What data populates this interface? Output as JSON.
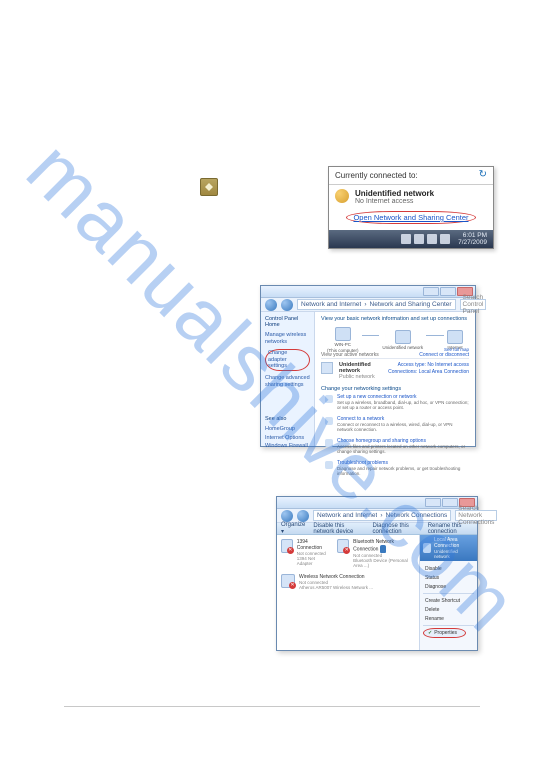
{
  "watermark": "manualshive.com",
  "tray_icon": {
    "name": "network-tray"
  },
  "flyout": {
    "heading": "Currently connected to:",
    "network": {
      "name": "Unidentified network",
      "sub": "No Internet access"
    },
    "link": "Open Network and Sharing Center",
    "clock": {
      "time": "6:01 PM",
      "date": "7/27/2009"
    }
  },
  "win2": {
    "crumb_a": "Network and Internet",
    "crumb_b": "Network and Sharing Center",
    "search_ph": "Search Control Panel",
    "side": {
      "header": "Control Panel Home",
      "link1": "Manage wireless networks",
      "link2": "Change adapter settings",
      "link3": "Change advanced sharing settings",
      "see_also": "See also",
      "sa1": "HomeGroup",
      "sa2": "Internet Options",
      "sa3": "Windows Firewall"
    },
    "main": {
      "heading": "View your basic network information and set up connections",
      "node_pc": "WIN-PC",
      "node_pc_sub": "(This computer)",
      "node_net": "Unidentified network",
      "node_inet": "Internet",
      "see_full": "See full map",
      "view_active": "View your active networks",
      "connect_disc": "Connect or disconnect",
      "active_name": "Unidentified network",
      "active_sub": "Public network",
      "access_lbl": "Access type:",
      "access_val": "No Internet access",
      "conn_lbl": "Connections:",
      "conn_val": "Local Area Connection",
      "change_head": "Change your networking settings",
      "t1_t": "Set up a new connection or network",
      "t1_d": "Set up a wireless, broadband, dial-up, ad hoc, or VPN connection; or set up a router or access point.",
      "t2_t": "Connect to a network",
      "t2_d": "Connect or reconnect to a wireless, wired, dial-up, or VPN network connection.",
      "t3_t": "Choose homegroup and sharing options",
      "t3_d": "Access files and printers located on other network computers, or change sharing settings.",
      "t4_t": "Troubleshoot problems",
      "t4_d": "Diagnose and repair network problems, or get troubleshooting information."
    }
  },
  "win3": {
    "crumb_a": "Network and Internet",
    "crumb_b": "Network Connections",
    "search_ph": "Search Network Connections",
    "tool1": "Organize ▾",
    "tool2": "Disable this network device",
    "tool3": "Diagnose this connection",
    "tool4": "Rename this connection",
    "conns": {
      "c0_n": "1394 Connection",
      "c0_s": "Not connected",
      "c0_d": "1394 Net Adapter",
      "c1_n": "Bluetooth Network Connection",
      "c1_s": "Not connected",
      "c1_d": "Bluetooth Device (Personal Area ...)",
      "c2_n": "Wireless Network Connection",
      "c2_s": "Not connected",
      "c2_d": "Atheros AR5007 Wireless Network ...",
      "c3_n": "Local Area Connection",
      "c3_s": "Unidentified network"
    },
    "menu": {
      "m0": "Disable",
      "m1": "Status",
      "m2": "Diagnose",
      "m3": "Create Shortcut",
      "m4": "Delete",
      "m5": "Rename",
      "m6": "Properties"
    }
  }
}
